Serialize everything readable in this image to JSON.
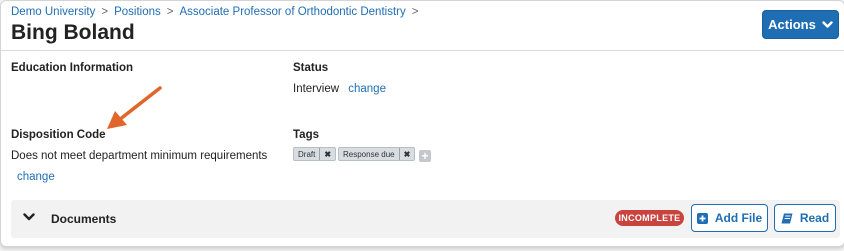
{
  "breadcrumb": {
    "items": [
      "Demo University",
      "Positions",
      "Associate Professor of Orthodontic Dentistry"
    ],
    "separator": ">"
  },
  "page_title": "Bing Boland",
  "actions": {
    "label": "Actions",
    "icon": "chevron-down-icon"
  },
  "education": {
    "label": "Education Information"
  },
  "status": {
    "label": "Status",
    "value": "Interview",
    "change_link": "change"
  },
  "disposition": {
    "label": "Disposition Code",
    "value": "Does not meet department minimum requirements",
    "change_link": "change"
  },
  "tags": {
    "label": "Tags",
    "items": [
      {
        "label": "Draft",
        "remove": "✖"
      },
      {
        "label": "Response due",
        "remove": "✖"
      }
    ],
    "add_icon": "plus-icon"
  },
  "documents": {
    "title": "Documents",
    "badge": "INCOMPLETE",
    "add_file_label": "Add File",
    "read_label": "Read"
  },
  "colors": {
    "primary": "#1f6db3",
    "badge_red": "#c9443f",
    "annotation_arrow": "#e0662b"
  }
}
